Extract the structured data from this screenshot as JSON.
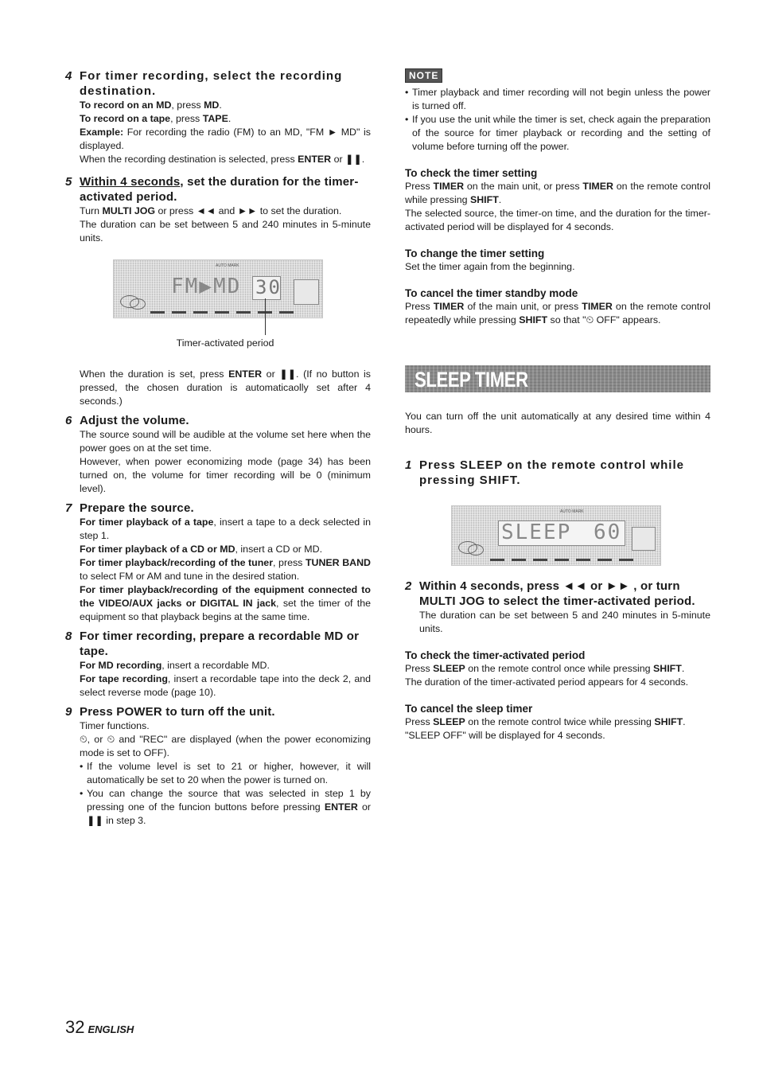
{
  "left": {
    "step4": {
      "num": "4",
      "title": "For timer recording, select the recording destination.",
      "lines": [
        {
          "b": "To record on an MD",
          "t": ", press ",
          "b2": "MD",
          "t2": "."
        },
        {
          "b": "To record on a tape",
          "t": ", press ",
          "b2": "TAPE",
          "t2": "."
        },
        {
          "b": "Example:",
          "t": " For recording the radio (FM) to an MD, \"FM ► MD\" is displayed."
        },
        {
          "t": "When the recording destination is selected, press ",
          "b": "ENTER",
          "t2": " or ❚❚."
        }
      ]
    },
    "step5": {
      "num": "5",
      "title_underlined": "Within 4 seconds",
      "title_rest": ", set the duration for the timer-activated period.",
      "line1_a": "Turn ",
      "line1_b": "MULTI JOG",
      "line1_c": " or press ◄◄ and ►► to set the duration.",
      "line2": "The duration can be set between 5 and 240 minutes in 5-minute units.",
      "display": {
        "text": "FM▶MD",
        "value": "30",
        "auto_mark": "AUTO MARK"
      },
      "caption": "Timer-activated period",
      "after_a": "When the duration is set, press ",
      "after_b": "ENTER",
      "after_c": " or ❚❚. (If no button is pressed, the chosen duration is automaticaolly set after 4 seconds.)"
    },
    "step6": {
      "num": "6",
      "title": "Adjust the volume.",
      "p1": "The source sound will be audible at the volume set here when the power goes on at the set time.",
      "p2": "However, when power economizing mode (page 34) has been turned on, the volume for timer recording will be 0 (minimum level)."
    },
    "step7": {
      "num": "7",
      "title": "Prepare the source.",
      "items": [
        {
          "b": "For timer playback of a tape",
          "t": ", insert a tape to a deck selected in step 1."
        },
        {
          "b": "For timer playback of a CD or MD",
          "t": ", insert a CD or MD."
        },
        {
          "b": "For timer playback/recording of the tuner",
          "t": ", press ",
          "b2": "TUNER BAND",
          "t2": " to select FM or AM and tune in the desired station."
        },
        {
          "b": "For timer playback/recording of the equipment connected to the VIDEO/AUX jacks or DIGITAL IN jack",
          "t": ", set the timer of the equipment so that playback begins at the same time."
        }
      ]
    },
    "step8": {
      "num": "8",
      "title": "For timer recording, prepare a recordable MD or tape.",
      "items": [
        {
          "b": "For MD recording",
          "t": ", insert a recordable MD."
        },
        {
          "b": "For tape recording",
          "t": ", insert a recordable tape into the deck 2, and select reverse mode (page 10)."
        }
      ]
    },
    "step9": {
      "num": "9",
      "title": "Press POWER to turn off the unit.",
      "p1": "Timer functions.",
      "p2": "⏲, or ⏲ and \"REC\" are displayed (when the power economizing mode is set to OFF).",
      "bullets": [
        {
          "t": "If the volume level is set to 21 or higher, however, it will automatically be set to 20 when the power is turned on."
        },
        {
          "t": "You can change the source that was selected in step 1 by pressing one of the funcion buttons before pressing ",
          "b": "ENTER",
          "t2": " or ❚❚ in step 3."
        }
      ]
    }
  },
  "right": {
    "note_label": "NOTE",
    "notes": [
      "Timer playback and timer recording will not begin unless the power is turned off.",
      "If you use the unit while the timer is set, check again the preparation of the source for timer playback or recording and the setting of volume before turning off the power."
    ],
    "check": {
      "title": "To check the timer setting",
      "a": "Press ",
      "b": "TIMER",
      "c": " on the main unit, or press ",
      "d": "TIMER",
      "e": " on the remote control while pressing ",
      "f": "SHIFT",
      "g": ".",
      "p2": "The selected source, the timer-on time, and the duration for the timer-activated period will be displayed for 4 seconds."
    },
    "change": {
      "title": "To change the timer setting",
      "p": "Set the timer again from the beginning."
    },
    "cancel_standby": {
      "title": "To cancel the timer standby mode",
      "a": "Press ",
      "b": "TIMER",
      "c": " of the main unit, or press ",
      "d": "TIMER",
      "e": " on the remote control repeatedly while pressing ",
      "f": "SHIFT",
      "g": " so that \"⏲ OFF\" appears."
    },
    "banner": "SLEEP TIMER",
    "intro": "You can turn off the unit automatically at any desired time within 4 hours.",
    "sstep1": {
      "num": "1",
      "title": "Press SLEEP on the remote control while pressing SHIFT."
    },
    "display": {
      "text": "SLEEP",
      "value": "60",
      "auto_mark": "AUTO MARK"
    },
    "sstep2": {
      "num": "2",
      "title": "Within 4 seconds, press ◄◄ or ►► , or turn MULTI JOG to select the timer-activated period.",
      "p": "The duration can be set between 5 and 240 minutes in 5-minute units."
    },
    "check_period": {
      "title": "To check the timer-activated period",
      "a": "Press ",
      "b": "SLEEP",
      "c": " on the remote control once while pressing ",
      "d": "SHIFT",
      "e": ".",
      "p2": "The duration of the timer-activated period appears for 4 seconds."
    },
    "cancel_sleep": {
      "title": "To cancel the sleep timer",
      "a": "Press ",
      "b": "SLEEP",
      "c": " on the remote control twice while pressing ",
      "d": "SHIFT",
      "e": ".",
      "p2": "\"SLEEP OFF\" will be displayed for 4 seconds."
    }
  },
  "footer": {
    "page": "32",
    "lang": "ENGLISH"
  }
}
